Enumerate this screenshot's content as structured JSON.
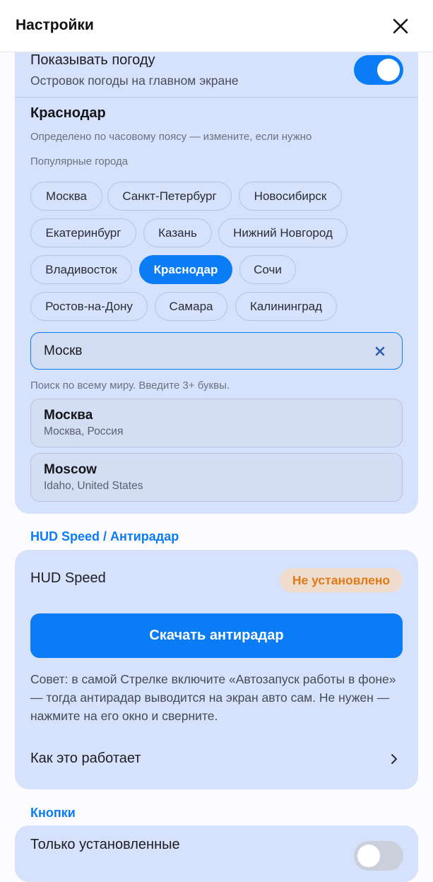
{
  "header": {
    "title": "Настройки"
  },
  "weather": {
    "title": "Показывать погоду",
    "subtitle": "Островок погоды на главном экране",
    "enabled": true,
    "city_name": "Краснодар",
    "city_hint": "Определено по часовому поясу — измените, если нужно",
    "popular_label": "Популярные города",
    "chips": [
      {
        "label": "Москва",
        "active": false
      },
      {
        "label": "Санкт-Петербург",
        "active": false
      },
      {
        "label": "Новосибирск",
        "active": false
      },
      {
        "label": "Екатеринбург",
        "active": false
      },
      {
        "label": "Казань",
        "active": false
      },
      {
        "label": "Нижний Новгород",
        "active": false
      },
      {
        "label": "Владивосток",
        "active": false
      },
      {
        "label": "Краснодар",
        "active": true
      },
      {
        "label": "Сочи",
        "active": false
      },
      {
        "label": "Ростов-на-Дону",
        "active": false
      },
      {
        "label": "Самара",
        "active": false
      },
      {
        "label": "Калининград",
        "active": false
      }
    ],
    "search": {
      "value": "Москв",
      "hint": "Поиск по всему миру. Введите 3+ буквы."
    },
    "results": [
      {
        "name": "Москва",
        "sub": "Москва, Россия"
      },
      {
        "name": "Moscow",
        "sub": "Idaho, United States"
      }
    ]
  },
  "hud": {
    "section_label": "HUD Speed / Антирадар",
    "title": "HUD Speed",
    "status": "Не установлено",
    "download_label": "Скачать антирадар",
    "tip": "Совет: в самой Стрелке включите «Автозапуск работы в фоне» — тогда антирадар выводится на экран авто сам. Не нужен — нажмите на его окно и сверните.",
    "how_label": "Как это работает"
  },
  "buttons": {
    "section_label": "Кнопки",
    "only_installed_label": "Только установленные",
    "only_installed_enabled": false
  },
  "colors": {
    "accent": "#0a7cf5",
    "card": "#d6e1fb",
    "warning": "#e07a16"
  }
}
